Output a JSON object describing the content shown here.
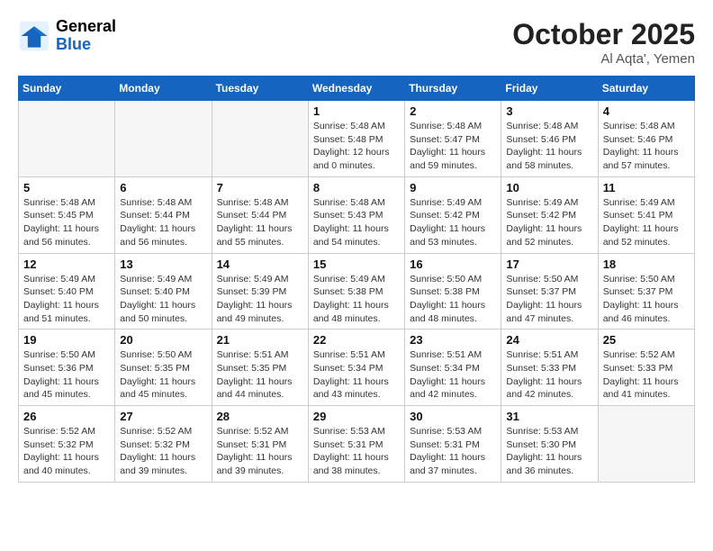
{
  "header": {
    "logo_general": "General",
    "logo_blue": "Blue",
    "month": "October 2025",
    "location": "Al Aqta', Yemen"
  },
  "weekdays": [
    "Sunday",
    "Monday",
    "Tuesday",
    "Wednesday",
    "Thursday",
    "Friday",
    "Saturday"
  ],
  "weeks": [
    [
      {
        "day": "",
        "info": ""
      },
      {
        "day": "",
        "info": ""
      },
      {
        "day": "",
        "info": ""
      },
      {
        "day": "1",
        "info": "Sunrise: 5:48 AM\nSunset: 5:48 PM\nDaylight: 12 hours\nand 0 minutes."
      },
      {
        "day": "2",
        "info": "Sunrise: 5:48 AM\nSunset: 5:47 PM\nDaylight: 11 hours\nand 59 minutes."
      },
      {
        "day": "3",
        "info": "Sunrise: 5:48 AM\nSunset: 5:46 PM\nDaylight: 11 hours\nand 58 minutes."
      },
      {
        "day": "4",
        "info": "Sunrise: 5:48 AM\nSunset: 5:46 PM\nDaylight: 11 hours\nand 57 minutes."
      }
    ],
    [
      {
        "day": "5",
        "info": "Sunrise: 5:48 AM\nSunset: 5:45 PM\nDaylight: 11 hours\nand 56 minutes."
      },
      {
        "day": "6",
        "info": "Sunrise: 5:48 AM\nSunset: 5:44 PM\nDaylight: 11 hours\nand 56 minutes."
      },
      {
        "day": "7",
        "info": "Sunrise: 5:48 AM\nSunset: 5:44 PM\nDaylight: 11 hours\nand 55 minutes."
      },
      {
        "day": "8",
        "info": "Sunrise: 5:48 AM\nSunset: 5:43 PM\nDaylight: 11 hours\nand 54 minutes."
      },
      {
        "day": "9",
        "info": "Sunrise: 5:49 AM\nSunset: 5:42 PM\nDaylight: 11 hours\nand 53 minutes."
      },
      {
        "day": "10",
        "info": "Sunrise: 5:49 AM\nSunset: 5:42 PM\nDaylight: 11 hours\nand 52 minutes."
      },
      {
        "day": "11",
        "info": "Sunrise: 5:49 AM\nSunset: 5:41 PM\nDaylight: 11 hours\nand 52 minutes."
      }
    ],
    [
      {
        "day": "12",
        "info": "Sunrise: 5:49 AM\nSunset: 5:40 PM\nDaylight: 11 hours\nand 51 minutes."
      },
      {
        "day": "13",
        "info": "Sunrise: 5:49 AM\nSunset: 5:40 PM\nDaylight: 11 hours\nand 50 minutes."
      },
      {
        "day": "14",
        "info": "Sunrise: 5:49 AM\nSunset: 5:39 PM\nDaylight: 11 hours\nand 49 minutes."
      },
      {
        "day": "15",
        "info": "Sunrise: 5:49 AM\nSunset: 5:38 PM\nDaylight: 11 hours\nand 48 minutes."
      },
      {
        "day": "16",
        "info": "Sunrise: 5:50 AM\nSunset: 5:38 PM\nDaylight: 11 hours\nand 48 minutes."
      },
      {
        "day": "17",
        "info": "Sunrise: 5:50 AM\nSunset: 5:37 PM\nDaylight: 11 hours\nand 47 minutes."
      },
      {
        "day": "18",
        "info": "Sunrise: 5:50 AM\nSunset: 5:37 PM\nDaylight: 11 hours\nand 46 minutes."
      }
    ],
    [
      {
        "day": "19",
        "info": "Sunrise: 5:50 AM\nSunset: 5:36 PM\nDaylight: 11 hours\nand 45 minutes."
      },
      {
        "day": "20",
        "info": "Sunrise: 5:50 AM\nSunset: 5:35 PM\nDaylight: 11 hours\nand 45 minutes."
      },
      {
        "day": "21",
        "info": "Sunrise: 5:51 AM\nSunset: 5:35 PM\nDaylight: 11 hours\nand 44 minutes."
      },
      {
        "day": "22",
        "info": "Sunrise: 5:51 AM\nSunset: 5:34 PM\nDaylight: 11 hours\nand 43 minutes."
      },
      {
        "day": "23",
        "info": "Sunrise: 5:51 AM\nSunset: 5:34 PM\nDaylight: 11 hours\nand 42 minutes."
      },
      {
        "day": "24",
        "info": "Sunrise: 5:51 AM\nSunset: 5:33 PM\nDaylight: 11 hours\nand 42 minutes."
      },
      {
        "day": "25",
        "info": "Sunrise: 5:52 AM\nSunset: 5:33 PM\nDaylight: 11 hours\nand 41 minutes."
      }
    ],
    [
      {
        "day": "26",
        "info": "Sunrise: 5:52 AM\nSunset: 5:32 PM\nDaylight: 11 hours\nand 40 minutes."
      },
      {
        "day": "27",
        "info": "Sunrise: 5:52 AM\nSunset: 5:32 PM\nDaylight: 11 hours\nand 39 minutes."
      },
      {
        "day": "28",
        "info": "Sunrise: 5:52 AM\nSunset: 5:31 PM\nDaylight: 11 hours\nand 39 minutes."
      },
      {
        "day": "29",
        "info": "Sunrise: 5:53 AM\nSunset: 5:31 PM\nDaylight: 11 hours\nand 38 minutes."
      },
      {
        "day": "30",
        "info": "Sunrise: 5:53 AM\nSunset: 5:31 PM\nDaylight: 11 hours\nand 37 minutes."
      },
      {
        "day": "31",
        "info": "Sunrise: 5:53 AM\nSunset: 5:30 PM\nDaylight: 11 hours\nand 36 minutes."
      },
      {
        "day": "",
        "info": ""
      }
    ]
  ]
}
